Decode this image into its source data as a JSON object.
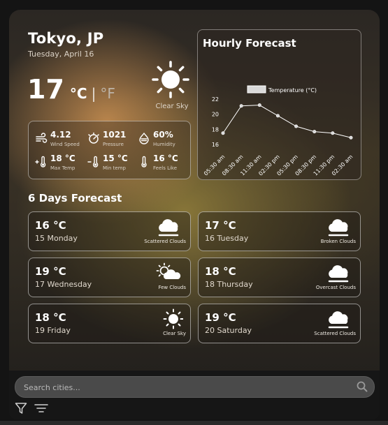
{
  "location": {
    "city": "Tokyo, JP",
    "date": "Tuesday, April 16"
  },
  "current": {
    "temp": "17",
    "unit_c": "°C",
    "separator": "|",
    "unit_f": "°F",
    "condition": "Clear Sky",
    "icon": "sun-icon"
  },
  "stats": [
    {
      "value": "4.12",
      "label": "Wind Speed",
      "icon": "wind-icon"
    },
    {
      "value": "1021",
      "label": "Pressure",
      "icon": "pressure-gauge-icon"
    },
    {
      "value": "60%",
      "label": "Humidity",
      "icon": "humidity-icon"
    },
    {
      "value": "18 °C",
      "label": "Max Temp",
      "icon": "thermometer-plus-icon"
    },
    {
      "value": "15 °C",
      "label": "Min temp",
      "icon": "thermometer-minus-icon"
    },
    {
      "value": "16 °C",
      "label": "Feels Like",
      "icon": "thermometer-icon"
    }
  ],
  "hourly": {
    "title": "Hourly Forecast",
    "legend": "Temperature (°C)"
  },
  "chart_data": {
    "type": "line",
    "title": "Hourly Forecast",
    "x": [
      "05:30 am",
      "08:30 am",
      "11:30 am",
      "02:30 pm",
      "05:30 pm",
      "08:30 pm",
      "11:30 pm",
      "02:30 am"
    ],
    "series": [
      {
        "name": "Temperature (°C)",
        "values": [
          17.5,
          21.1,
          21.2,
          19.8,
          18.4,
          17.7,
          17.5,
          16.9
        ]
      }
    ],
    "yticks": [
      "16",
      "18",
      "20",
      "22"
    ],
    "ylim": [
      16,
      22
    ],
    "grid": false,
    "legend_position": "top-center",
    "line_color": "#ffffff"
  },
  "forecast": {
    "title": "6 Days Forecast",
    "days": [
      {
        "temp": "16 °C",
        "day": "15 Monday",
        "condition": "Scattered Clouds",
        "icon": "scattered-clouds-icon"
      },
      {
        "temp": "17 °C",
        "day": "16 Tuesday",
        "condition": "Broken Clouds",
        "icon": "broken-clouds-icon"
      },
      {
        "temp": "19 °C",
        "day": "17 Wednesday",
        "condition": "Few Clouds",
        "icon": "few-clouds-icon"
      },
      {
        "temp": "18 °C",
        "day": "18 Thursday",
        "condition": "Overcast Clouds",
        "icon": "overcast-clouds-icon"
      },
      {
        "temp": "18 °C",
        "day": "19 Friday",
        "condition": "Clear Sky",
        "icon": "sun-icon"
      },
      {
        "temp": "19 °C",
        "day": "20 Saturday",
        "condition": "Scattered Clouds",
        "icon": "scattered-clouds-icon"
      }
    ]
  },
  "search": {
    "placeholder": "Search cities..."
  }
}
